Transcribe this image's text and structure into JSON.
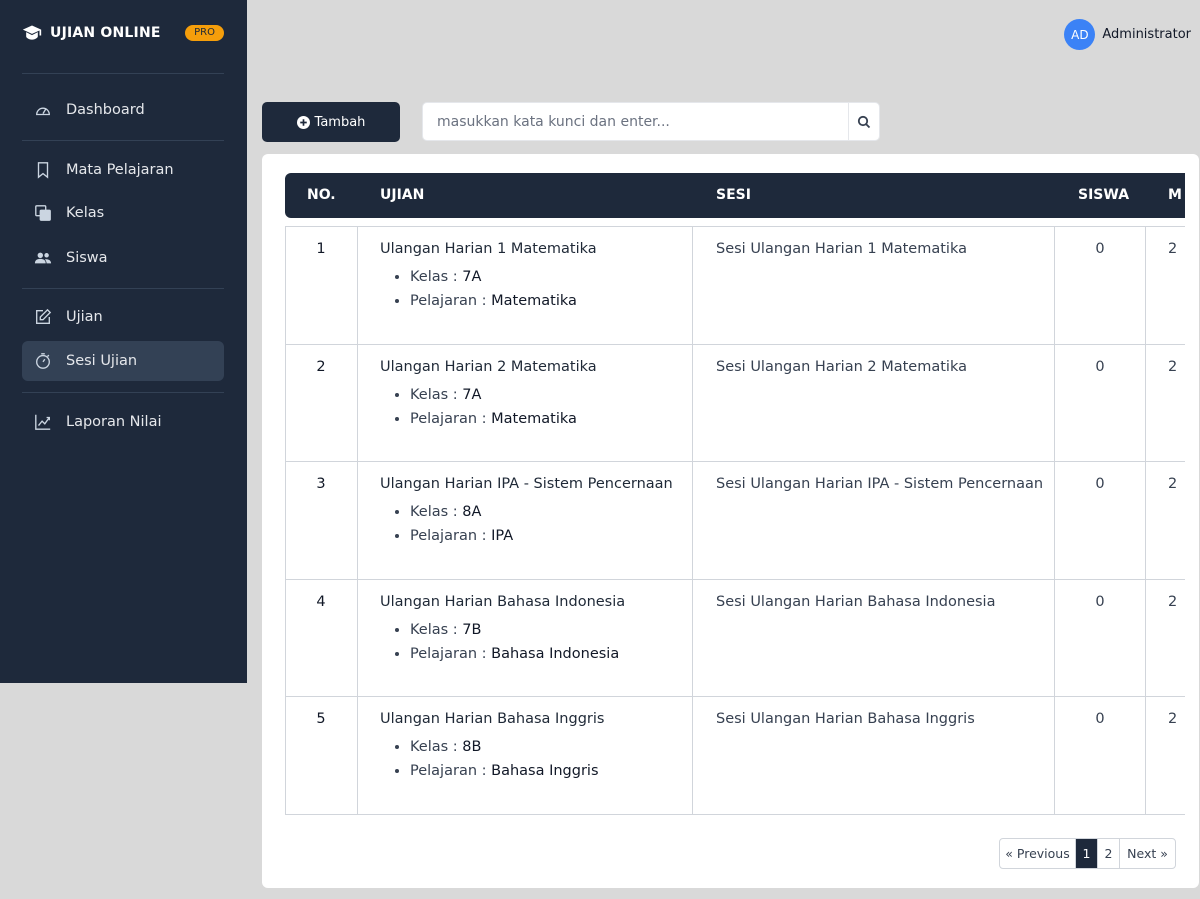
{
  "brand": {
    "name": "UJIAN ONLINE",
    "badge": "PRO"
  },
  "user": {
    "initials": "AD",
    "name": "Administrator"
  },
  "sidebar": {
    "items": [
      {
        "label": "Dashboard",
        "icon": "dashboard-gauge-icon"
      },
      {
        "label": "Mata Pelajaran",
        "icon": "bookmark-icon"
      },
      {
        "label": "Kelas",
        "icon": "copy-icon"
      },
      {
        "label": "Siswa",
        "icon": "users-icon"
      },
      {
        "label": "Ujian",
        "icon": "edit-icon"
      },
      {
        "label": "Sesi Ujian",
        "icon": "stopwatch-icon",
        "active": true
      },
      {
        "label": "Laporan Nilai",
        "icon": "chart-line-icon"
      }
    ]
  },
  "toolbar": {
    "add_label": "Tambah",
    "search_placeholder": "masukkan kata kunci dan enter..."
  },
  "table": {
    "headers": {
      "no": "NO.",
      "ujian": "UJIAN",
      "sesi": "SESI",
      "siswa": "SISWA",
      "mulai": "M"
    },
    "rows": [
      {
        "no": "1",
        "ujian": "Ulangan Harian 1 Matematika",
        "kelas_label": "Kelas : ",
        "kelas": "7A",
        "pelajaran_label": "Pelajaran : ",
        "pelajaran": "Matematika",
        "sesi": "Sesi Ulangan Harian 1 Matematika",
        "siswa": "0",
        "mulai": "2"
      },
      {
        "no": "2",
        "ujian": "Ulangan Harian 2 Matematika",
        "kelas_label": "Kelas : ",
        "kelas": "7A",
        "pelajaran_label": "Pelajaran : ",
        "pelajaran": "Matematika",
        "sesi": "Sesi Ulangan Harian 2 Matematika",
        "siswa": "0",
        "mulai": "2"
      },
      {
        "no": "3",
        "ujian": "Ulangan Harian IPA - Sistem Pencernaan",
        "kelas_label": "Kelas : ",
        "kelas": "8A",
        "pelajaran_label": "Pelajaran : ",
        "pelajaran": "IPA",
        "sesi": "Sesi Ulangan Harian IPA - Sistem Pencernaan",
        "siswa": "0",
        "mulai": "2"
      },
      {
        "no": "4",
        "ujian": "Ulangan Harian Bahasa Indonesia",
        "kelas_label": "Kelas : ",
        "kelas": "7B",
        "pelajaran_label": "Pelajaran : ",
        "pelajaran": "Bahasa Indonesia",
        "sesi": "Sesi Ulangan Harian Bahasa Indonesia",
        "siswa": "0",
        "mulai": "2"
      },
      {
        "no": "5",
        "ujian": "Ulangan Harian Bahasa Inggris",
        "kelas_label": "Kelas : ",
        "kelas": "8B",
        "pelajaran_label": "Pelajaran : ",
        "pelajaran": "Bahasa Inggris",
        "sesi": "Sesi Ulangan Harian Bahasa Inggris",
        "siswa": "0",
        "mulai": "2"
      }
    ]
  },
  "pagination": {
    "previous": "« Previous",
    "pages": [
      "1",
      "2"
    ],
    "current": "1",
    "next": "Next »"
  },
  "colors": {
    "sidebar_bg": "#1e293b",
    "accent": "#3b82f6",
    "badge": "#f59e0b",
    "page_bg": "#d9d9d9"
  }
}
